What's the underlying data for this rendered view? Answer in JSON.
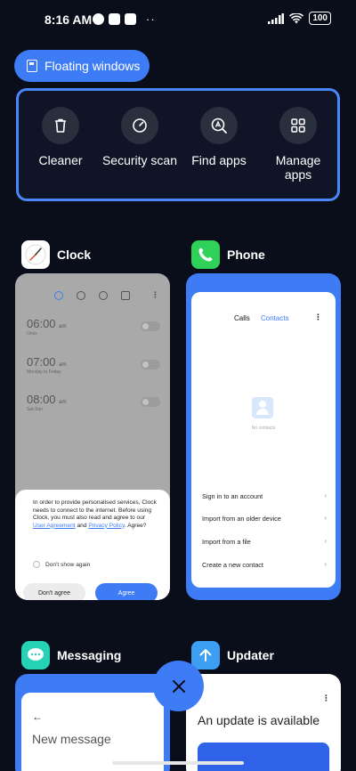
{
  "status_bar": {
    "time": "8:16 AM",
    "battery": "100",
    "overflow": "··"
  },
  "floating_windows": {
    "label": "Floating windows"
  },
  "tools": [
    {
      "label": "Cleaner",
      "icon": "trash-icon"
    },
    {
      "label": "Security scan",
      "icon": "gauge-icon"
    },
    {
      "label": "Find apps",
      "icon": "search-app-icon"
    },
    {
      "label": "Manage apps",
      "icon": "grid-icon"
    }
  ],
  "apps": {
    "clock": {
      "name": "Clock",
      "alarms": [
        {
          "time": "06:00",
          "ampm": "am",
          "sub": "Once"
        },
        {
          "time": "07:00",
          "ampm": "am",
          "sub": "Monday to Friday"
        },
        {
          "time": "08:00",
          "ampm": "am",
          "sub": "Sat-Sun"
        }
      ],
      "dialog": {
        "text_before": "In order to provide personalised services, Clock needs to connect to the internet. Before using Clock, you must also read and agree to our ",
        "link1": "User Agreement",
        "and": " and ",
        "link2": "Privacy Policy",
        "text_after": ". Agree?",
        "checkbox_label": "Don't show again",
        "cancel": "Don't agree",
        "confirm": "Agree"
      }
    },
    "phone": {
      "name": "Phone",
      "tabs": [
        "Calls",
        "Contacts"
      ],
      "empty_text": "No contacts",
      "rows": [
        "Sign in to an account",
        "Import from an older device",
        "Import from a file",
        "Create a new contact"
      ]
    },
    "messaging": {
      "name": "Messaging",
      "title": "New message"
    },
    "updater": {
      "name": "Updater",
      "title": "An update is available"
    }
  },
  "colors": {
    "accent": "#3e7cf6",
    "background": "#0a0d1a"
  }
}
